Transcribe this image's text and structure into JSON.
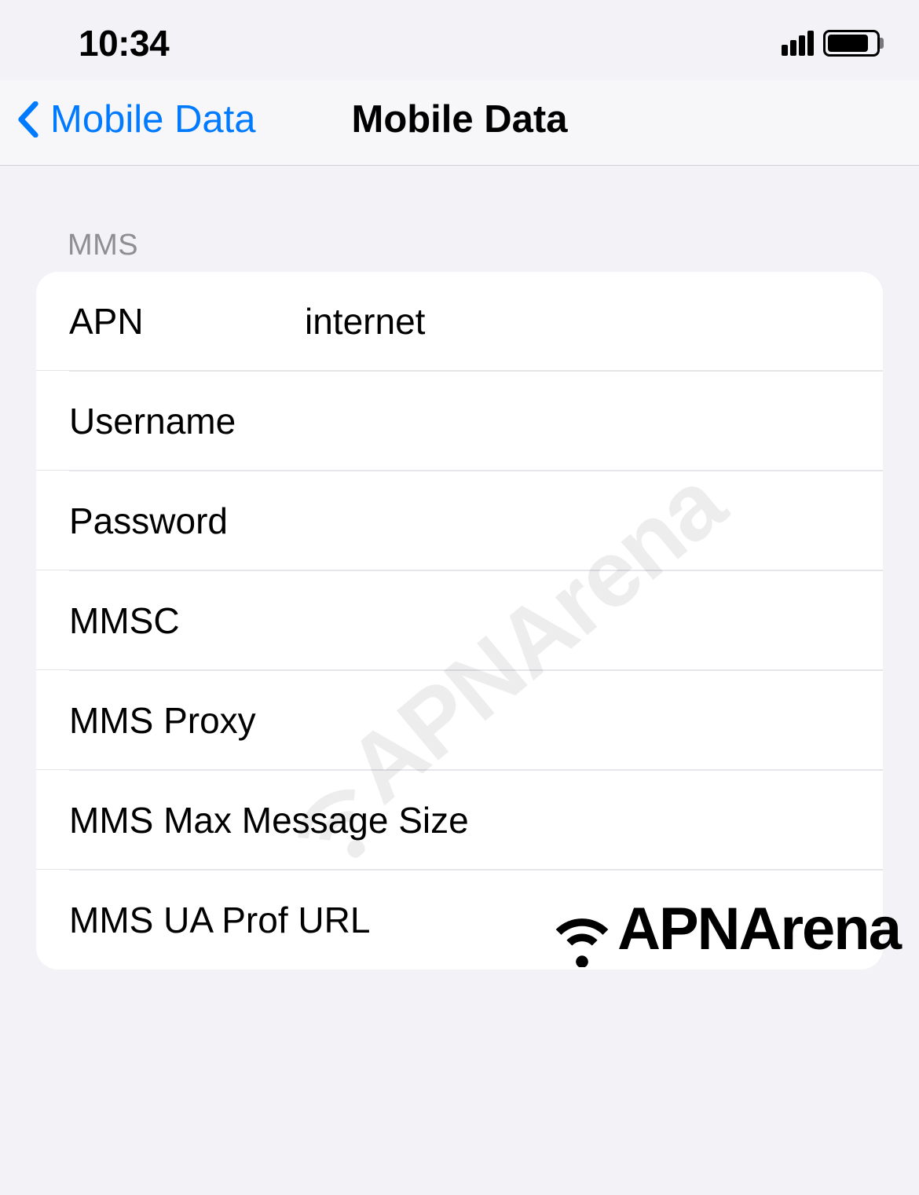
{
  "status_bar": {
    "time": "10:34"
  },
  "nav": {
    "back_label": "Mobile Data",
    "title": "Mobile Data"
  },
  "section": {
    "header": "MMS",
    "rows": [
      {
        "label": "APN",
        "value": "internet"
      },
      {
        "label": "Username",
        "value": ""
      },
      {
        "label": "Password",
        "value": ""
      },
      {
        "label": "MMSC",
        "value": ""
      },
      {
        "label": "MMS Proxy",
        "value": ""
      },
      {
        "label": "MMS Max Message Size",
        "value": ""
      },
      {
        "label": "MMS UA Prof URL",
        "value": ""
      }
    ]
  },
  "watermark": "APNArena",
  "branding": "APNArena"
}
